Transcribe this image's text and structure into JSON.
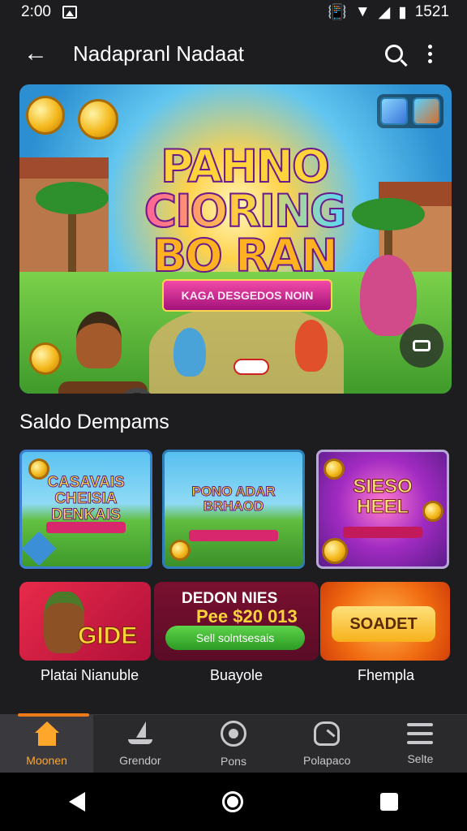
{
  "status_bar": {
    "time": "2:00",
    "battery_text": "1521"
  },
  "app_bar": {
    "title": "Nadapranl Nadaat"
  },
  "banner": {
    "headline": [
      "PAHNO",
      "CIORING",
      "BO RAN"
    ],
    "ribbon": "KAGA DESGEDOS NOIN"
  },
  "section": {
    "title": "Saldo Dempams"
  },
  "tiles": [
    {
      "title": "CASAVAIS CHEISIA DENKAIS"
    },
    {
      "title": "PONO ADAR BRHAOD"
    },
    {
      "title": "SIESO HEEL"
    }
  ],
  "promos": [
    {
      "word": "GIDE",
      "caption": "Platai Nianuble"
    },
    {
      "line1": "DEDON NIES",
      "line2": "Pee $20 013",
      "button": "Sell solntsesais",
      "caption": "Buayole"
    },
    {
      "pill": "SOADET",
      "caption": "Fhempla"
    }
  ],
  "bottom_nav": [
    {
      "label": "Moonen",
      "icon": "home-icon",
      "active": true
    },
    {
      "label": "Grendor",
      "icon": "boat-icon",
      "active": false
    },
    {
      "label": "Pons",
      "icon": "target-icon",
      "active": false
    },
    {
      "label": "Polapaco",
      "icon": "gauge-icon",
      "active": false
    },
    {
      "label": "Selte",
      "icon": "menu-icon",
      "active": false
    }
  ],
  "colors": {
    "accent": "#f07a18",
    "background": "#1d1d20",
    "nav_bg": "#2a2a2d"
  }
}
